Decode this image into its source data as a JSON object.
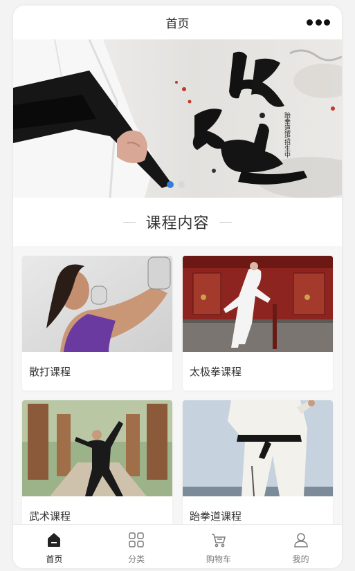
{
  "navbar": {
    "title": "首页",
    "more_icon": "more-dots-icon"
  },
  "banner": {
    "main_text_top": "跆",
    "main_text_bottom": "拳道",
    "vertical_text": "跆拳道馆/招生中",
    "dots_total": 2,
    "dots_active": 0
  },
  "section": {
    "title": "课程内容"
  },
  "courses": [
    {
      "label": "散打课程"
    },
    {
      "label": "太极拳课程"
    },
    {
      "label": "武术课程"
    },
    {
      "label": "跆拳道课程"
    }
  ],
  "tabbar": {
    "items": [
      {
        "label": "首页",
        "icon": "home-icon",
        "active": true
      },
      {
        "label": "分类",
        "icon": "category-grid-icon",
        "active": false
      },
      {
        "label": "购物车",
        "icon": "cart-icon",
        "active": false
      },
      {
        "label": "我的",
        "icon": "user-icon",
        "active": false
      }
    ]
  },
  "colors": {
    "accent": "#2f7fd8",
    "text": "#333333",
    "tab_inactive": "#7a7a7a"
  }
}
